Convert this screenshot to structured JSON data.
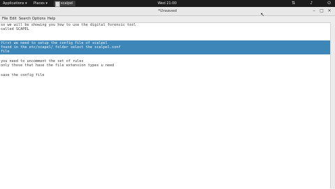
{
  "topbar": {
    "applications": "Applications ▾",
    "places": "Places ▾",
    "app_name": "scalpel",
    "clock": "Wed 21:00",
    "status_icons": [
      "network-icon",
      "volume-icon",
      "power-icon"
    ]
  },
  "window": {
    "title": "*Unsaved",
    "buttons": [
      "minimize",
      "maximize",
      "close"
    ]
  },
  "menubar": [
    "File",
    "Edit",
    "Search",
    "Options",
    "Help"
  ],
  "editor": {
    "lines": [
      "so we will be showing you how to use the digital forensic tool",
      "called SCAPEL",
      "",
      "",
      "first we need to setup the config file of scalpel",
      "found in the etc/scapel/ folder select the scalpel.conf",
      "file",
      "",
      "you need to uncomment the set of rules",
      "only those that have the file extension types u need",
      "",
      "",
      "save the config file"
    ],
    "selected_lines": [
      4,
      5,
      6
    ],
    "selection_color": "#3d87b8"
  }
}
